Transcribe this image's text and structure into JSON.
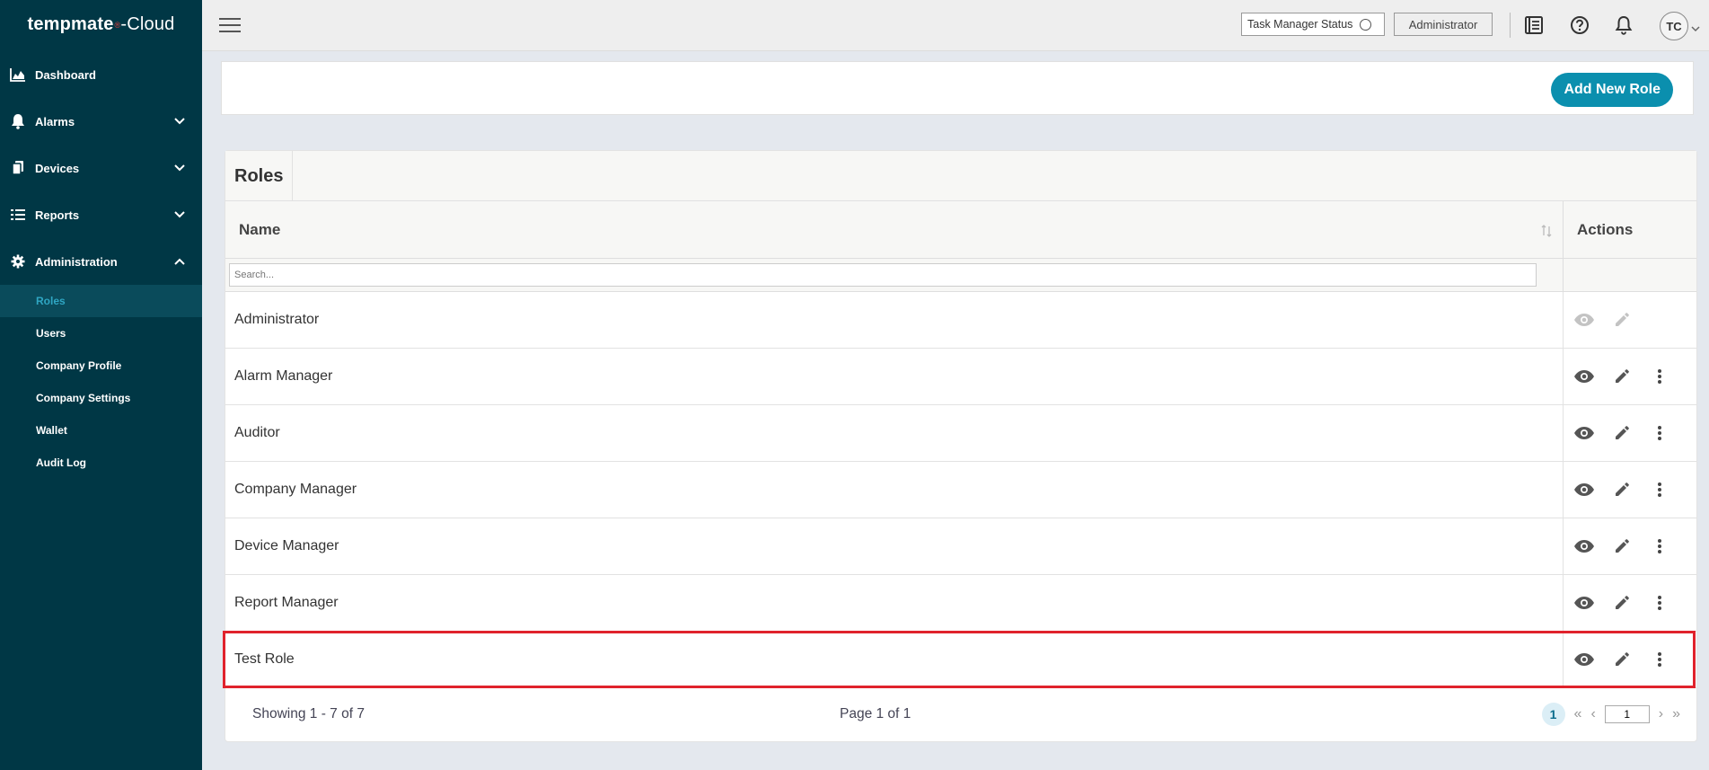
{
  "app": {
    "logo_text": "tempmate",
    "logo_mark": "®",
    "logo_suffix": "-Cloud"
  },
  "sidebar": {
    "items": [
      {
        "label": "Dashboard",
        "icon": "chart-area-icon"
      },
      {
        "label": "Alarms",
        "icon": "bell-icon",
        "expanded": false
      },
      {
        "label": "Devices",
        "icon": "devices-icon",
        "expanded": false
      },
      {
        "label": "Reports",
        "icon": "list-icon",
        "expanded": false
      },
      {
        "label": "Administration",
        "icon": "gear-icon",
        "expanded": true
      }
    ],
    "sub_items": [
      {
        "label": "Roles",
        "active": true
      },
      {
        "label": "Users",
        "active": false
      },
      {
        "label": "Company Profile",
        "active": false
      },
      {
        "label": "Company Settings",
        "active": false
      },
      {
        "label": "Wallet",
        "active": false
      },
      {
        "label": "Audit Log",
        "active": false
      }
    ]
  },
  "topbar": {
    "task_manager_label": "Task Manager Status",
    "role_button": "Administrator",
    "avatar_initials": "TC"
  },
  "toolbar": {
    "add_role_label": "Add New Role"
  },
  "roles": {
    "title": "Roles",
    "col_name": "Name",
    "col_actions": "Actions",
    "search_placeholder": "Search...",
    "rows": [
      {
        "name": "Administrator",
        "actions_enabled": false,
        "has_menu": false
      },
      {
        "name": "Alarm Manager",
        "actions_enabled": true,
        "has_menu": true
      },
      {
        "name": "Auditor",
        "actions_enabled": true,
        "has_menu": true
      },
      {
        "name": "Company Manager",
        "actions_enabled": true,
        "has_menu": true
      },
      {
        "name": "Device Manager",
        "actions_enabled": true,
        "has_menu": true
      },
      {
        "name": "Report Manager",
        "actions_enabled": true,
        "has_menu": true
      },
      {
        "name": "Test Role",
        "actions_enabled": true,
        "has_menu": true,
        "highlighted": true
      }
    ]
  },
  "pagination": {
    "showing": "Showing 1 - 7 of 7",
    "page_of": "Page 1 of 1",
    "current_page": "1",
    "first": "«",
    "prev": "‹",
    "next": "›",
    "last": "»",
    "page_input_value": "1"
  },
  "colors": {
    "sidebar_bg": "#003745",
    "accent": "#0b8fae",
    "highlight": "#e0222c"
  }
}
